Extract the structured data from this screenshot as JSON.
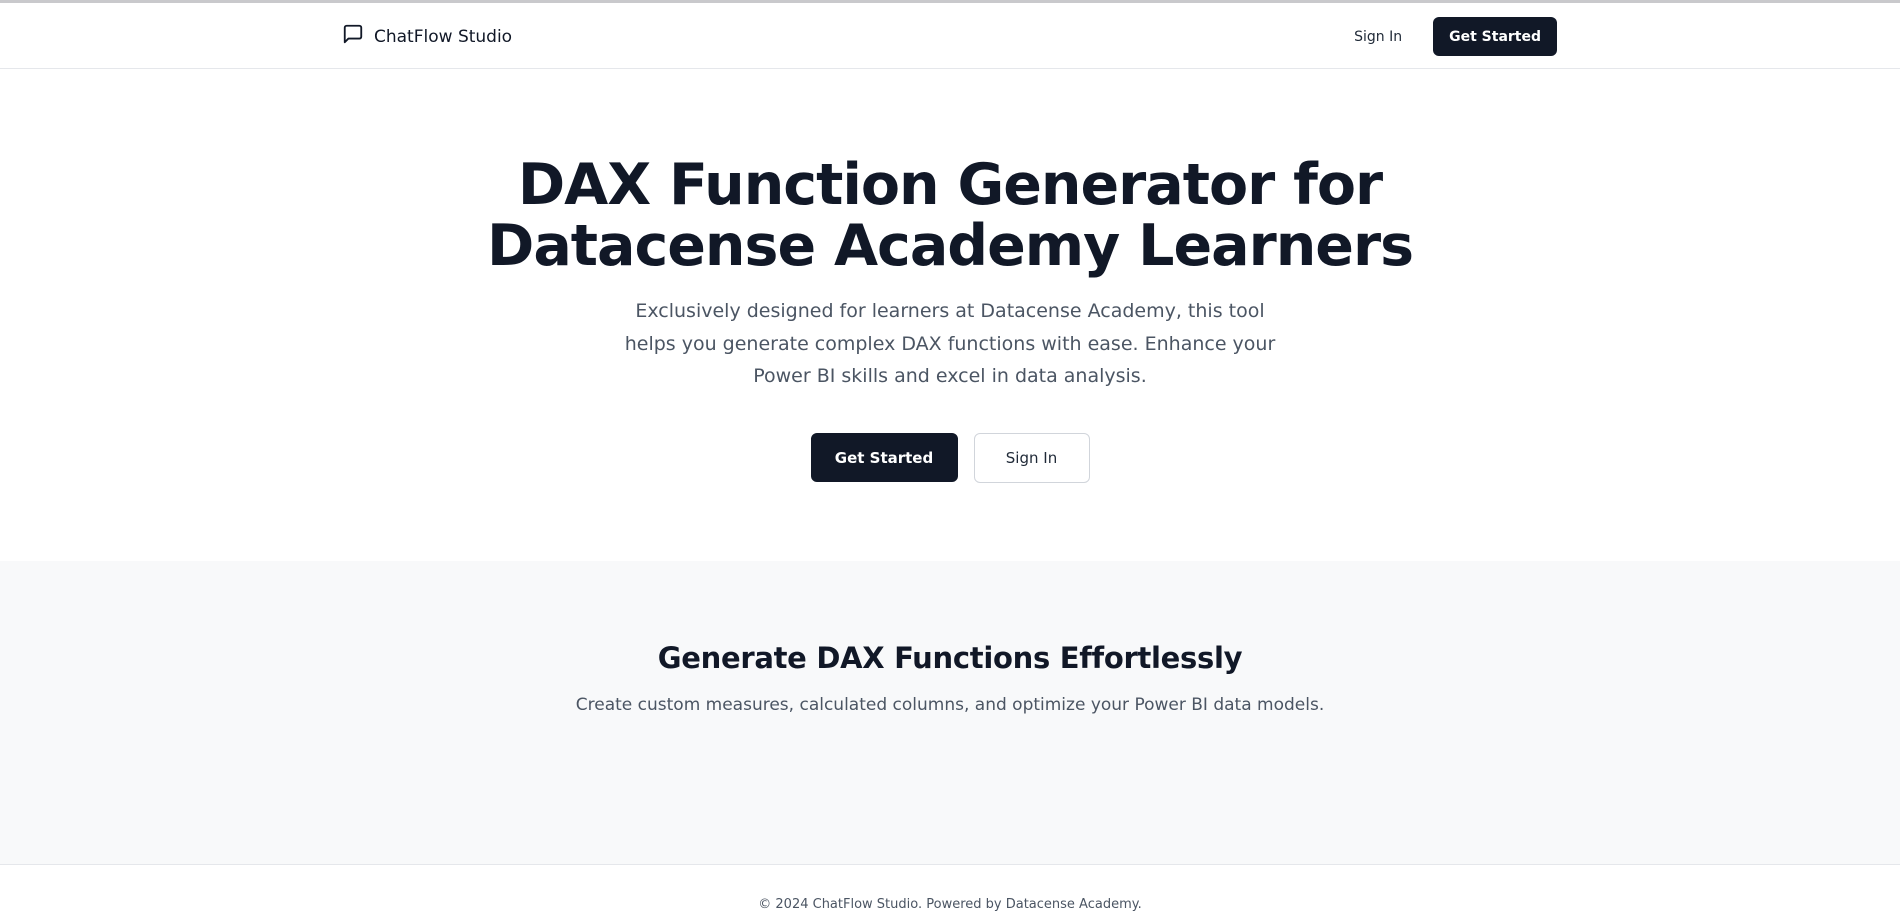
{
  "header": {
    "brand_name": "ChatFlow Studio",
    "brand_icon": "message-square-icon",
    "signin_label": "Sign In",
    "get_started_label": "Get Started"
  },
  "hero": {
    "title_line1": "DAX Function Generator for",
    "title_line2": "Datacense Academy Learners",
    "description": "Exclusively designed for learners at Datacense Academy, this tool helps you generate complex DAX functions with ease. Enhance your Power BI skills and excel in data analysis.",
    "primary_button": "Get Started",
    "secondary_button": "Sign In"
  },
  "features": {
    "heading": "Generate DAX Functions Effortlessly",
    "subheading": "Create custom measures, calculated columns, and optimize your Power BI data models."
  },
  "footer": {
    "copyright": "© 2024 ChatFlow Studio. Powered by Datacense Academy."
  },
  "colors": {
    "primary_dark": "#111827",
    "muted_text": "#4b5563",
    "section_bg": "#f8f9fa"
  }
}
